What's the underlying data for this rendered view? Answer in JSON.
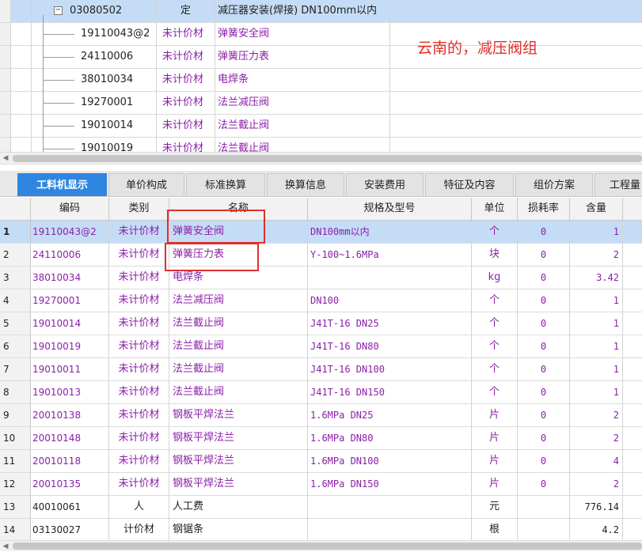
{
  "top_tree": {
    "parent": {
      "expander": "−",
      "code": "03080502",
      "type": "定",
      "name": "减压器安装(焊接) DN100mm以内"
    },
    "children": [
      {
        "code": "19110043@2",
        "type": "未计价材",
        "name": "弹簧安全阀"
      },
      {
        "code": "24110006",
        "type": "未计价材",
        "name": "弹簧压力表"
      },
      {
        "code": "38010034",
        "type": "未计价材",
        "name": "电焊条"
      },
      {
        "code": "19270001",
        "type": "未计价材",
        "name": "法兰减压阀"
      },
      {
        "code": "19010014",
        "type": "未计价材",
        "name": "法兰截止阀"
      },
      {
        "code": "19010019",
        "type": "未计价材",
        "name": "法兰截止阀"
      }
    ]
  },
  "annotation": "云南的，减压阀组",
  "scrollbar": {
    "left_arrow": "◀"
  },
  "tabs": [
    "工料机显示",
    "单价构成",
    "标准换算",
    "换算信息",
    "安装费用",
    "特征及内容",
    "组价方案",
    "工程量"
  ],
  "grid": {
    "headers": [
      "编码",
      "类别",
      "名称",
      "规格及型号",
      "单位",
      "损耗率",
      "含量"
    ],
    "rows": [
      {
        "n": "1",
        "code": "19110043@2",
        "type": "未计价材",
        "name": "弹簧安全阀",
        "spec": "DN100mm以内",
        "unit": "个",
        "loss": "0",
        "qty": "1"
      },
      {
        "n": "2",
        "code": "24110006",
        "type": "未计价材",
        "name": "弹簧压力表",
        "spec": "Y-100~1.6MPa",
        "unit": "块",
        "loss": "0",
        "qty": "2"
      },
      {
        "n": "3",
        "code": "38010034",
        "type": "未计价材",
        "name": "电焊条",
        "spec": "",
        "unit": "kg",
        "loss": "0",
        "qty": "3.42"
      },
      {
        "n": "4",
        "code": "19270001",
        "type": "未计价材",
        "name": "法兰减压阀",
        "spec": "DN100",
        "unit": "个",
        "loss": "0",
        "qty": "1"
      },
      {
        "n": "5",
        "code": "19010014",
        "type": "未计价材",
        "name": "法兰截止阀",
        "spec": "J41T-16 DN25",
        "unit": "个",
        "loss": "0",
        "qty": "1"
      },
      {
        "n": "6",
        "code": "19010019",
        "type": "未计价材",
        "name": "法兰截止阀",
        "spec": "J41T-16 DN80",
        "unit": "个",
        "loss": "0",
        "qty": "1"
      },
      {
        "n": "7",
        "code": "19010011",
        "type": "未计价材",
        "name": "法兰截止阀",
        "spec": "J41T-16 DN100",
        "unit": "个",
        "loss": "0",
        "qty": "1"
      },
      {
        "n": "8",
        "code": "19010013",
        "type": "未计价材",
        "name": "法兰截止阀",
        "spec": "J41T-16 DN150",
        "unit": "个",
        "loss": "0",
        "qty": "1"
      },
      {
        "n": "9",
        "code": "20010138",
        "type": "未计价材",
        "name": "钢板平焊法兰",
        "spec": "1.6MPa DN25",
        "unit": "片",
        "loss": "0",
        "qty": "2"
      },
      {
        "n": "10",
        "code": "20010148",
        "type": "未计价材",
        "name": "钢板平焊法兰",
        "spec": "1.6MPa DN80",
        "unit": "片",
        "loss": "0",
        "qty": "2"
      },
      {
        "n": "11",
        "code": "20010118",
        "type": "未计价材",
        "name": "钢板平焊法兰",
        "spec": "1.6MPa DN100",
        "unit": "片",
        "loss": "0",
        "qty": "4"
      },
      {
        "n": "12",
        "code": "20010135",
        "type": "未计价材",
        "name": "钢板平焊法兰",
        "spec": "1.6MPa DN150",
        "unit": "片",
        "loss": "0",
        "qty": "2"
      },
      {
        "n": "13",
        "code": "40010061",
        "type": "人",
        "name": "人工费",
        "spec": "",
        "unit": "元",
        "loss": "",
        "qty": "776.14"
      },
      {
        "n": "14",
        "code": "03130027",
        "type": "计价材",
        "name": "钢锯条",
        "spec": "",
        "unit": "根",
        "loss": "",
        "qty": "4.2"
      }
    ]
  },
  "colors": {
    "selected_row": "#c5dcf6",
    "unpriced_material": "#8b1fa8",
    "active_tab": "#2f86e0",
    "highlight_box": "#e0302c"
  }
}
